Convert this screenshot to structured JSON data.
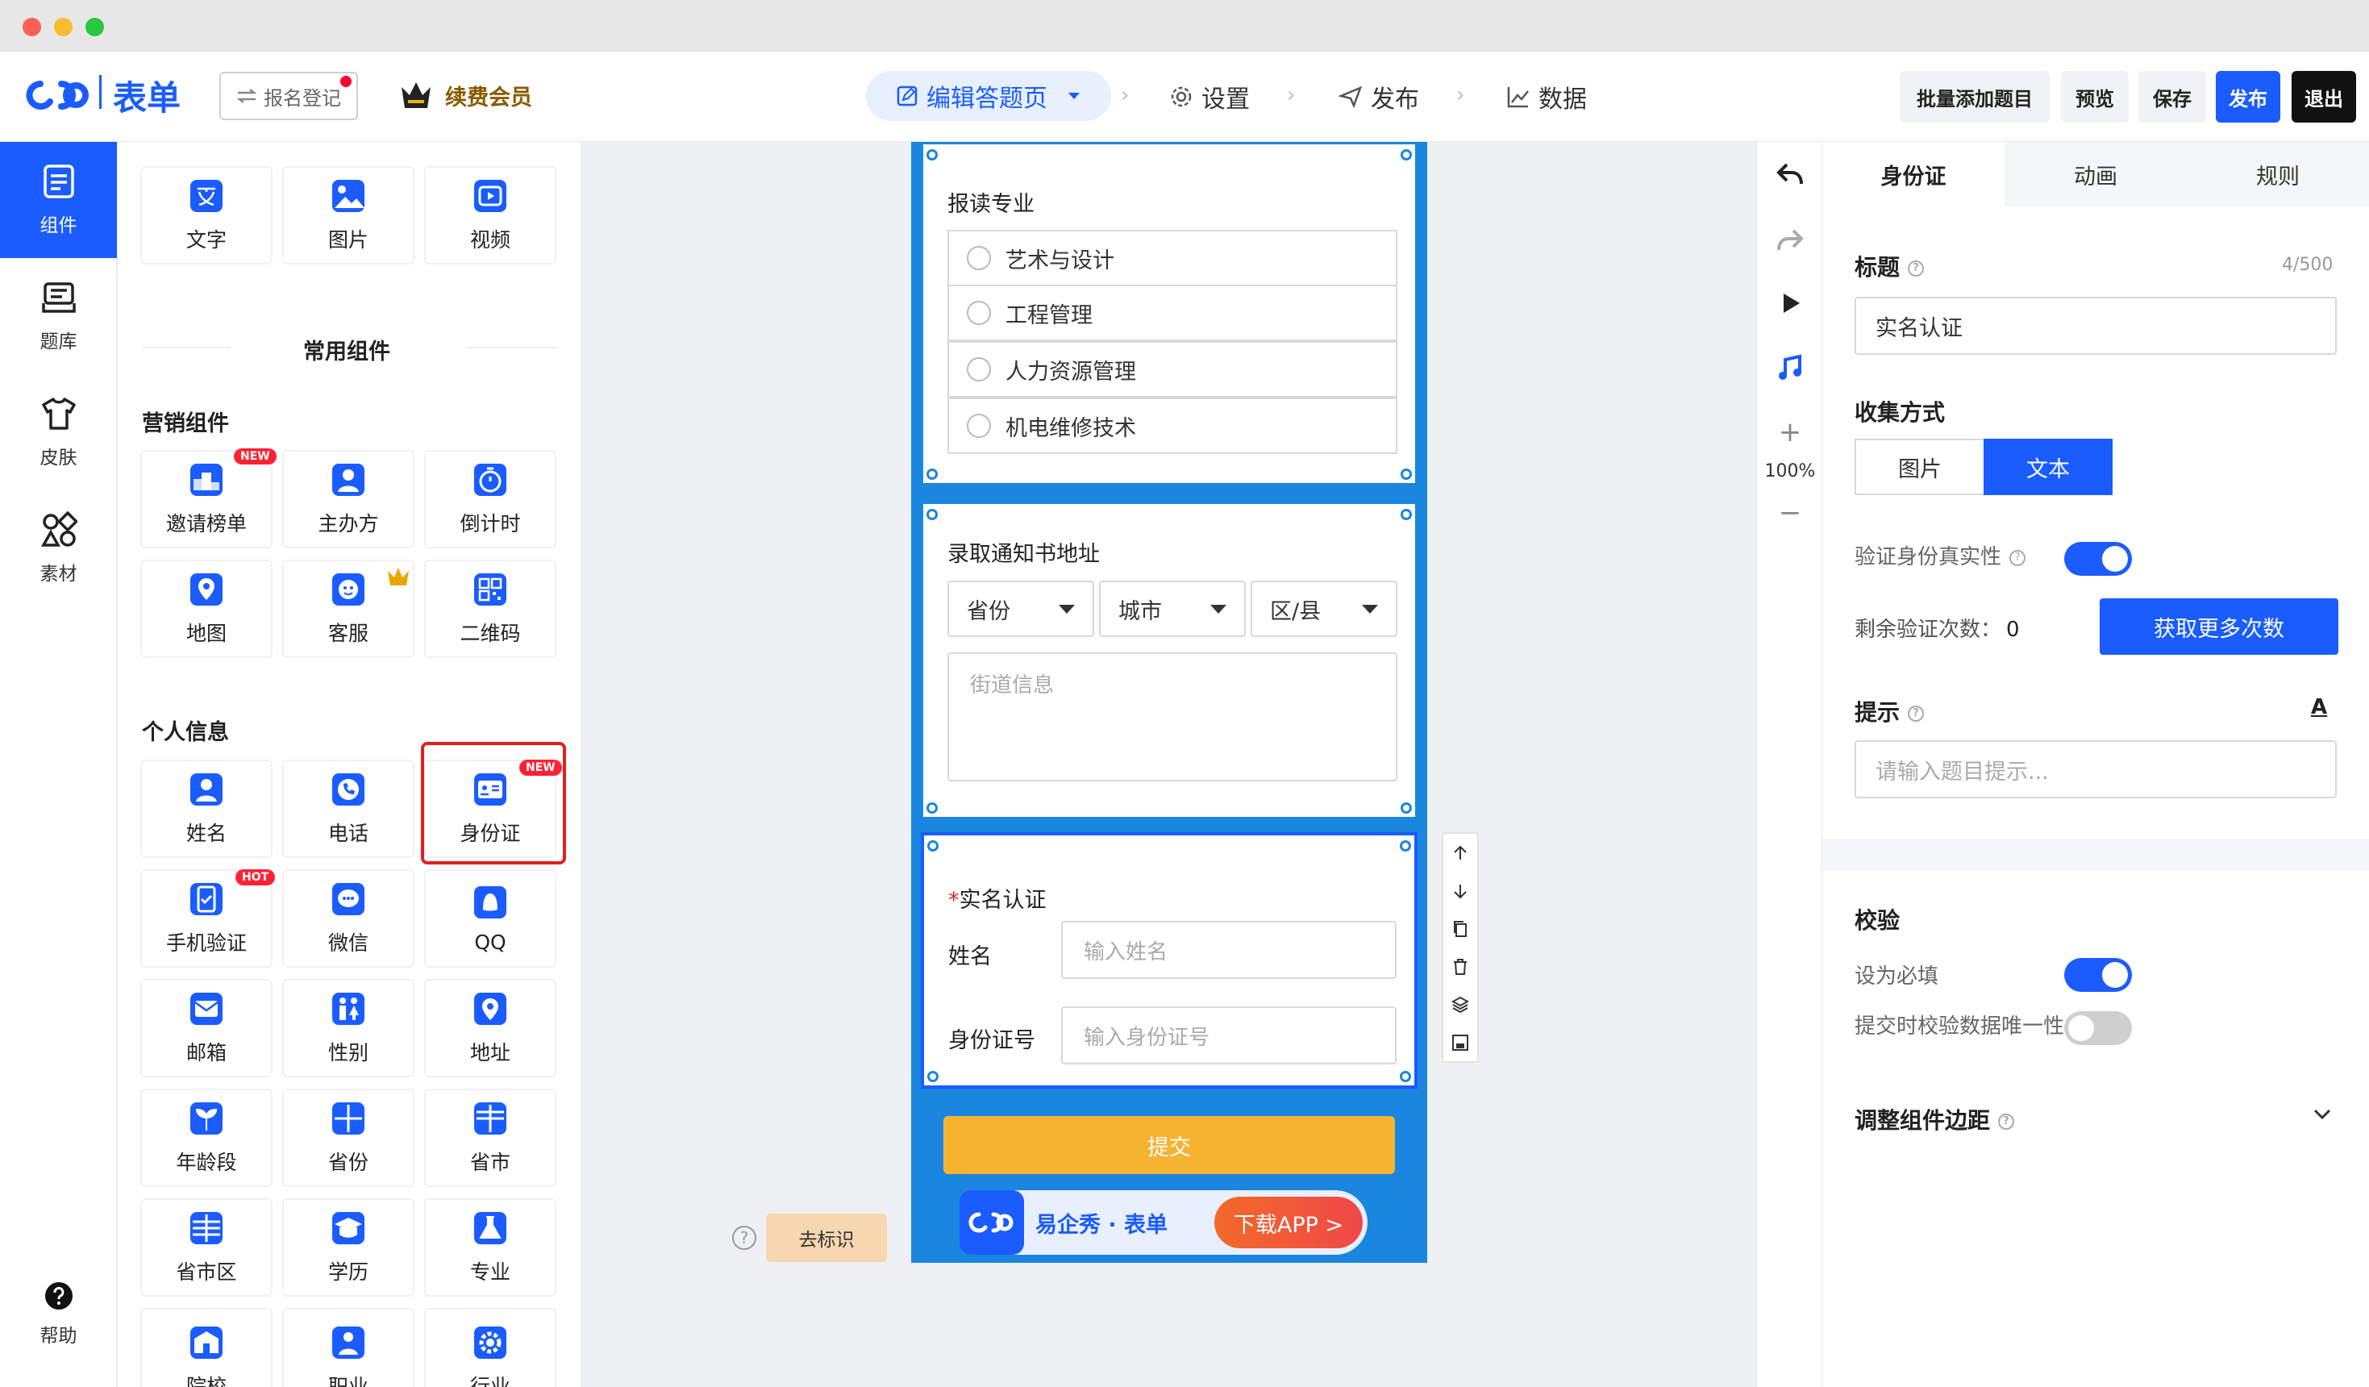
{
  "window": {
    "dots": [
      "#ff5f57",
      "#febc2e",
      "#28c840"
    ]
  },
  "app": {
    "logo_text": "表单",
    "project_label": "报名登记",
    "vip_label": "续费会员"
  },
  "nav": {
    "edit": "编辑答题页",
    "settings": "设置",
    "publish": "发布",
    "data": "数据"
  },
  "actions": {
    "batch_add": "批量添加题目",
    "preview": "预览",
    "save": "保存",
    "publish": "发布",
    "exit": "退出"
  },
  "rail": [
    {
      "label": "组件",
      "icon": "component-icon",
      "active": true
    },
    {
      "label": "题库",
      "icon": "question-bank-icon"
    },
    {
      "label": "皮肤",
      "icon": "skin-icon"
    },
    {
      "label": "素材",
      "icon": "material-icon"
    }
  ],
  "rail_help": "帮助",
  "panel": {
    "basic": [
      "文字",
      "图片",
      "视频"
    ],
    "common_title": "常用组件",
    "marketing_title": "营销组件",
    "marketing": [
      "邀请榜单",
      "主办方",
      "倒计时",
      "地图",
      "客服",
      "二维码"
    ],
    "personal_title": "个人信息",
    "personal": [
      "姓名",
      "电话",
      "身份证",
      "手机验证",
      "微信",
      "QQ",
      "邮箱",
      "性别",
      "地址",
      "年龄段",
      "省份",
      "省市",
      "省市区",
      "学历",
      "专业",
      "院校",
      "职业",
      "行业"
    ],
    "badges": {
      "new": "NEW",
      "hot": "HOT"
    }
  },
  "canvas": {
    "q1": {
      "title": "报读专业",
      "options": [
        "艺术与设计",
        "工程管理",
        "人力资源管理",
        "机电维修技术"
      ]
    },
    "q2": {
      "title": "录取通知书地址",
      "province": "省份",
      "city": "城市",
      "district": "区/县",
      "street_placeholder": "街道信息"
    },
    "q3": {
      "required_mark": "*",
      "title": "实名认证",
      "name_label": "姓名",
      "name_placeholder": "输入姓名",
      "id_label": "身份证号",
      "id_placeholder": "输入身份证号"
    },
    "submit": "提交",
    "brand": "易企秀 · 表单",
    "download": "下载APP >",
    "tag_button": "去标识",
    "help": "?"
  },
  "mini": {
    "zoom": "100%"
  },
  "right": {
    "tabs": [
      "身份证",
      "动画",
      "规则"
    ],
    "title_label": "标题",
    "title_count": "4/500",
    "title_value": "实名认证",
    "collect_label": "收集方式",
    "collect_options": [
      "图片",
      "文本"
    ],
    "verify_label": "验证身份真实性",
    "remain_label": "剩余验证次数：",
    "remain_count": "0",
    "get_more": "获取更多次数",
    "tip_label": "提示",
    "tip_font_icon": "A",
    "tip_placeholder": "请输入题目提示...",
    "check_label": "校验",
    "required_label": "设为必填",
    "unique_label": "提交时校验数据唯一性",
    "spacing_label": "调整组件边距",
    "toggles": {
      "verify": true,
      "required": true,
      "unique": false
    }
  },
  "colors": {
    "brand": "#1a5cff",
    "canvas_bg": "#1a86e0",
    "submit": "#f6b330",
    "highlight": "#e02020"
  }
}
